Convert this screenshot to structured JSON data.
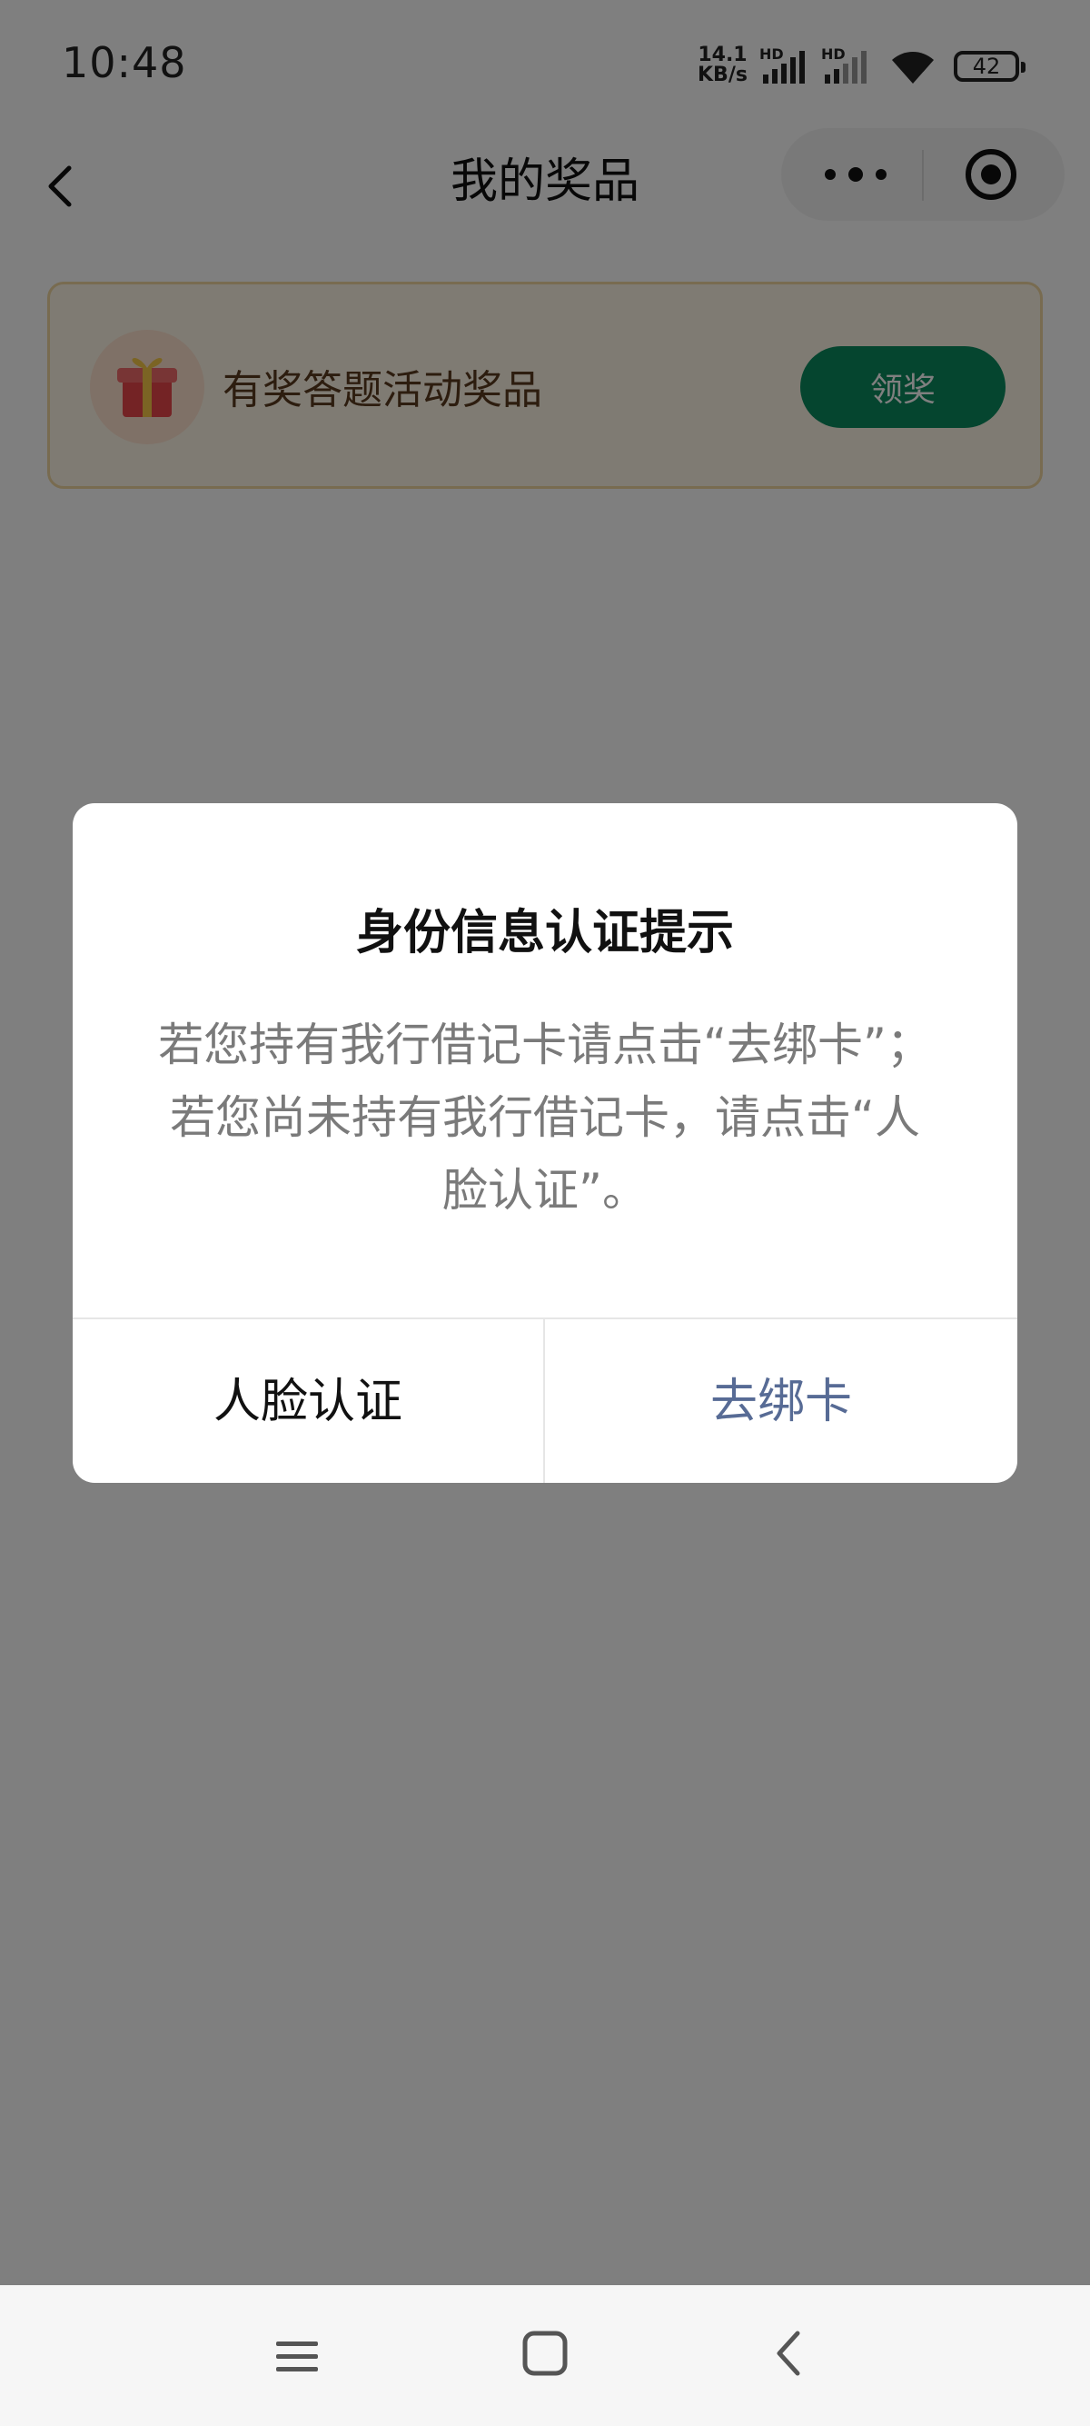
{
  "status_bar": {
    "time": "10:48",
    "net_speed_value": "14.1",
    "net_speed_unit": "KB/s",
    "sim1_tag": "HD",
    "sim2_tag": "HD",
    "battery": "42"
  },
  "nav": {
    "title": "我的奖品"
  },
  "prize": {
    "label": "有奖答题活动奖品",
    "claim_label": "领奖"
  },
  "dialog": {
    "title": "身份信息认证提示",
    "message": "若您持有我行借记卡请点击“去绑卡”；若您尚未持有我行借记卡，请点击“人脸认证”。",
    "face_auth_label": "人脸认证",
    "bind_card_label": "去绑卡"
  },
  "colors": {
    "accent_green": "#0b8a5e",
    "link_blue": "#576b95",
    "card_bg": "#fff6e6",
    "card_border": "#f0d7a0"
  },
  "icons": {
    "back": "chevron-left-icon",
    "more": "more-dots-icon",
    "close": "target-close-icon",
    "gift": "gift-icon",
    "wifi": "wifi-icon",
    "signal": "signal-icon",
    "battery": "battery-icon"
  }
}
